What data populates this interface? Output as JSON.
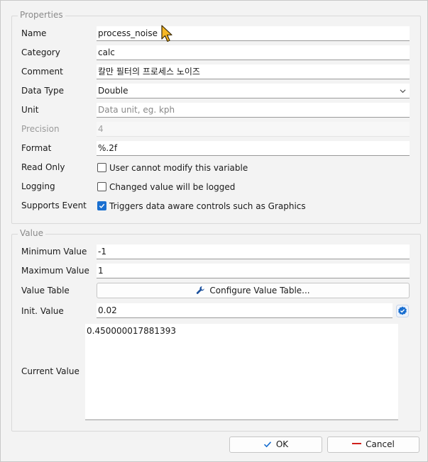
{
  "properties": {
    "title": "Properties",
    "name_label": "Name",
    "name_value": "process_noise",
    "category_label": "Category",
    "category_value": "calc",
    "comment_label": "Comment",
    "comment_value": "칼만 필터의 프로세스 노이즈",
    "data_type_label": "Data Type",
    "data_type_value": "Double",
    "unit_label": "Unit",
    "unit_placeholder": "Data unit, eg. kph",
    "precision_label": "Precision",
    "precision_value": "4",
    "format_label": "Format",
    "format_value": "%.2f",
    "read_only_label": "Read Only",
    "read_only_text": "User cannot modify this variable",
    "read_only_checked": false,
    "logging_label": "Logging",
    "logging_text": "Changed value will be logged",
    "logging_checked": false,
    "supports_event_label": "Supports Event",
    "supports_event_text": "Triggers data aware controls such as Graphics",
    "supports_event_checked": true
  },
  "value": {
    "title": "Value",
    "min_label": "Minimum Value",
    "min_value": "-1",
    "max_label": "Maximum Value",
    "max_value": "1",
    "table_label": "Value Table",
    "configure_button": "Configure Value Table...",
    "init_label": "Init. Value",
    "init_value": "0.02",
    "current_label": "Current Value",
    "current_value": "0.450000017881393"
  },
  "footer": {
    "ok_label": "OK",
    "cancel_label": "Cancel"
  },
  "colors": {
    "accent": "#1a6fd0",
    "cancel_red": "#d0201b"
  },
  "icons": [
    "chevron-down-icon",
    "check-icon",
    "wrench-icon",
    "verified-badge-icon",
    "cursor-pointer-icon"
  ]
}
